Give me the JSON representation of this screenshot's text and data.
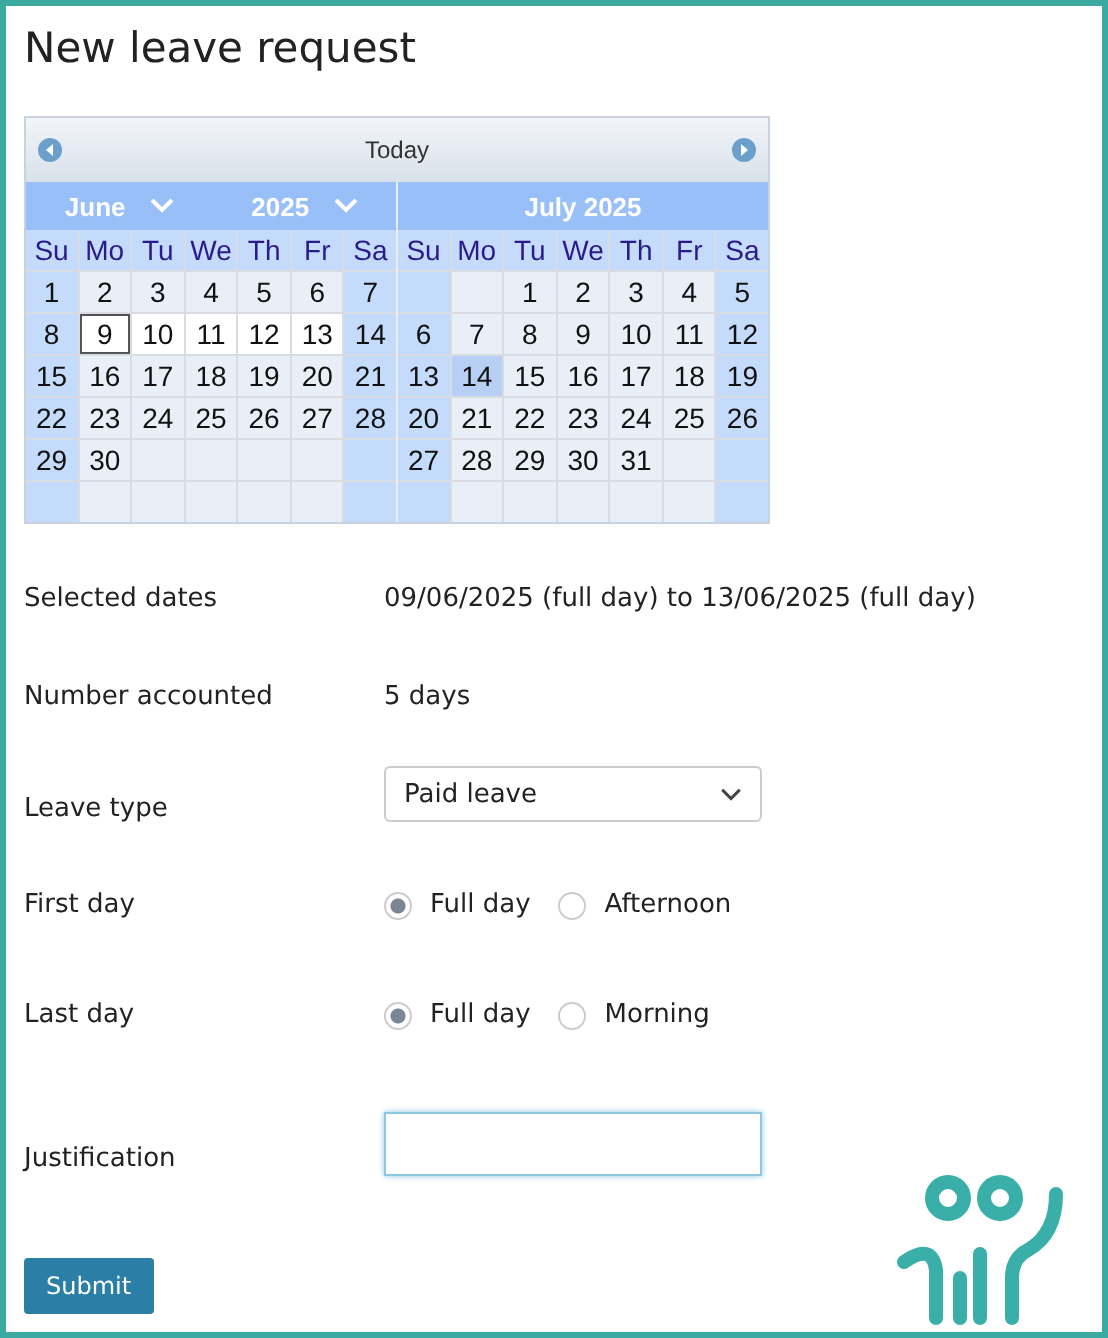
{
  "title": "New leave request",
  "calendar": {
    "today": "Today",
    "months": [
      {
        "kind": "select",
        "month": "June",
        "year": "2025",
        "weekdays": [
          "Su",
          "Mo",
          "Tu",
          "We",
          "Th",
          "Fr",
          "Sa"
        ],
        "weeks": [
          [
            {
              "d": "1",
              "kind": "day"
            },
            {
              "d": "2",
              "kind": "day"
            },
            {
              "d": "3",
              "kind": "day"
            },
            {
              "d": "4",
              "kind": "day"
            },
            {
              "d": "5",
              "kind": "day"
            },
            {
              "d": "6",
              "kind": "day"
            },
            {
              "d": "7",
              "kind": "day"
            }
          ],
          [
            {
              "d": "8",
              "kind": "day"
            },
            {
              "d": "9",
              "kind": "range_start"
            },
            {
              "d": "10",
              "kind": "range"
            },
            {
              "d": "11",
              "kind": "range"
            },
            {
              "d": "12",
              "kind": "range"
            },
            {
              "d": "13",
              "kind": "range"
            },
            {
              "d": "14",
              "kind": "day"
            }
          ],
          [
            {
              "d": "15",
              "kind": "day"
            },
            {
              "d": "16",
              "kind": "day"
            },
            {
              "d": "17",
              "kind": "day"
            },
            {
              "d": "18",
              "kind": "day"
            },
            {
              "d": "19",
              "kind": "day"
            },
            {
              "d": "20",
              "kind": "day"
            },
            {
              "d": "21",
              "kind": "day"
            }
          ],
          [
            {
              "d": "22",
              "kind": "day"
            },
            {
              "d": "23",
              "kind": "day"
            },
            {
              "d": "24",
              "kind": "day"
            },
            {
              "d": "25",
              "kind": "day"
            },
            {
              "d": "26",
              "kind": "day"
            },
            {
              "d": "27",
              "kind": "day"
            },
            {
              "d": "28",
              "kind": "day"
            }
          ],
          [
            {
              "d": "29",
              "kind": "day"
            },
            {
              "d": "30",
              "kind": "day"
            },
            {
              "kind": "blank"
            },
            {
              "kind": "blank"
            },
            {
              "kind": "blank"
            },
            {
              "kind": "blank"
            },
            {
              "kind": "blank"
            }
          ],
          [
            {
              "kind": "blank"
            },
            {
              "kind": "blank"
            },
            {
              "kind": "blank"
            },
            {
              "kind": "blank"
            },
            {
              "kind": "blank"
            },
            {
              "kind": "blank"
            },
            {
              "kind": "blank"
            }
          ]
        ]
      },
      {
        "kind": "title",
        "title": "July 2025",
        "weekdays": [
          "Su",
          "Mo",
          "Tu",
          "We",
          "Th",
          "Fr",
          "Sa"
        ],
        "weeks": [
          [
            {
              "kind": "blank"
            },
            {
              "kind": "blank"
            },
            {
              "d": "1",
              "kind": "day"
            },
            {
              "d": "2",
              "kind": "day"
            },
            {
              "d": "3",
              "kind": "day"
            },
            {
              "d": "4",
              "kind": "day"
            },
            {
              "d": "5",
              "kind": "day"
            }
          ],
          [
            {
              "d": "6",
              "kind": "day"
            },
            {
              "d": "7",
              "kind": "day"
            },
            {
              "d": "8",
              "kind": "day"
            },
            {
              "d": "9",
              "kind": "day"
            },
            {
              "d": "10",
              "kind": "day"
            },
            {
              "d": "11",
              "kind": "day"
            },
            {
              "d": "12",
              "kind": "day"
            }
          ],
          [
            {
              "d": "13",
              "kind": "day"
            },
            {
              "d": "14",
              "kind": "holiday"
            },
            {
              "d": "15",
              "kind": "day"
            },
            {
              "d": "16",
              "kind": "day"
            },
            {
              "d": "17",
              "kind": "day"
            },
            {
              "d": "18",
              "kind": "day"
            },
            {
              "d": "19",
              "kind": "day"
            }
          ],
          [
            {
              "d": "20",
              "kind": "day"
            },
            {
              "d": "21",
              "kind": "day"
            },
            {
              "d": "22",
              "kind": "day"
            },
            {
              "d": "23",
              "kind": "day"
            },
            {
              "d": "24",
              "kind": "day"
            },
            {
              "d": "25",
              "kind": "day"
            },
            {
              "d": "26",
              "kind": "day"
            }
          ],
          [
            {
              "d": "27",
              "kind": "day"
            },
            {
              "d": "28",
              "kind": "day"
            },
            {
              "d": "29",
              "kind": "day"
            },
            {
              "d": "30",
              "kind": "day"
            },
            {
              "d": "31",
              "kind": "day"
            },
            {
              "kind": "blank"
            },
            {
              "kind": "blank"
            }
          ],
          [
            {
              "kind": "blank"
            },
            {
              "kind": "blank"
            },
            {
              "kind": "blank"
            },
            {
              "kind": "blank"
            },
            {
              "kind": "blank"
            },
            {
              "kind": "blank"
            },
            {
              "kind": "blank"
            }
          ]
        ]
      }
    ]
  },
  "fields": [
    {
      "kind": "text",
      "label": "Selected dates",
      "value": "09/06/2025 (full day) to 13/06/2025 (full day)"
    },
    {
      "kind": "text",
      "label": "Number accounted",
      "value": "5 days"
    },
    {
      "kind": "select",
      "label": "Leave type",
      "value": "Paid leave"
    },
    {
      "kind": "radio",
      "label": "First day",
      "options": [
        {
          "label": "Full day",
          "selected": true
        },
        {
          "label": "Afternoon",
          "selected": false
        }
      ]
    },
    {
      "kind": "radio",
      "label": "Last day",
      "options": [
        {
          "label": "Full day",
          "selected": true
        },
        {
          "label": "Morning",
          "selected": false
        }
      ]
    },
    {
      "kind": "input",
      "label": "Justification"
    }
  ],
  "submit": "Submit"
}
